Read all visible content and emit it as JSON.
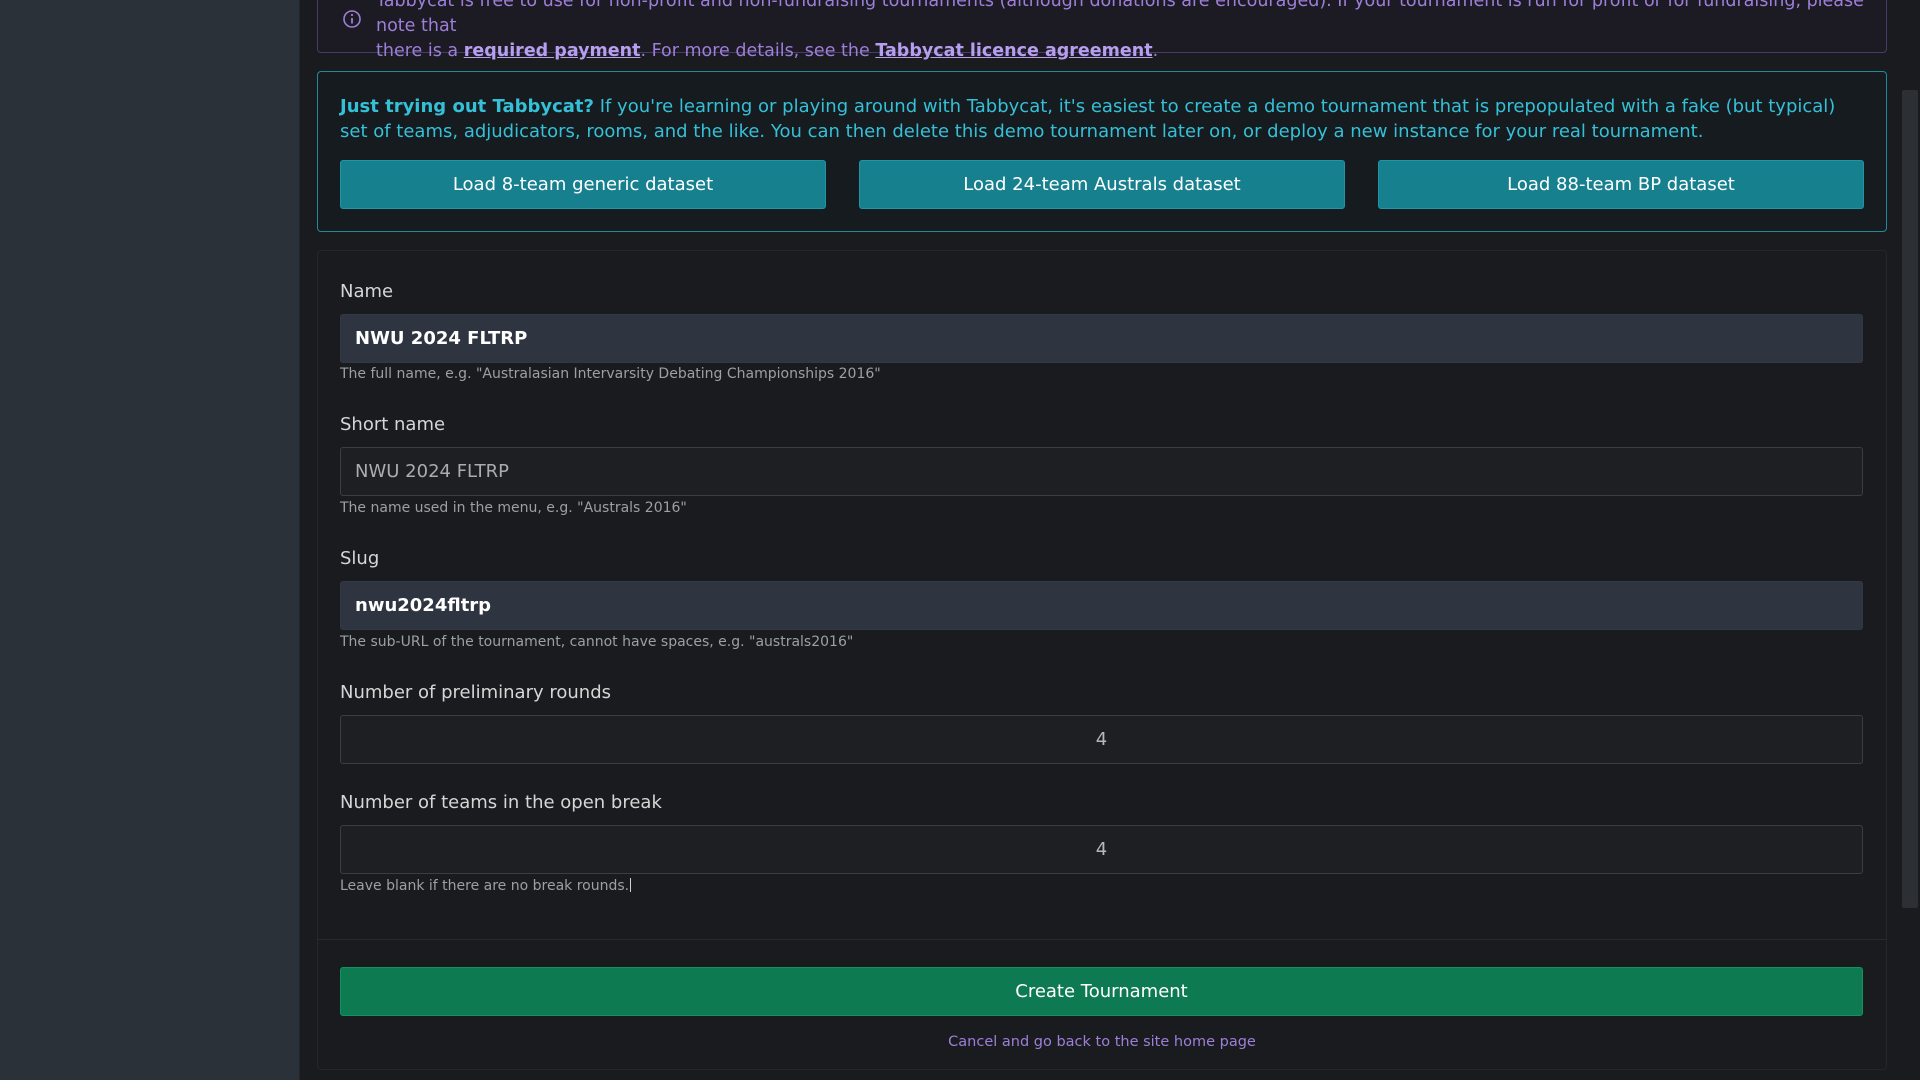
{
  "licence_notice": {
    "line1": "Tabbycat is free to use for non-profit and non-fundraising tournaments (although donations are encouraged). If your tournament is run for profit or for fundraising, please note that",
    "line2_prefix": "there is a ",
    "payment_link": "required payment",
    "line2_middle": ". For more details, see the ",
    "licence_link": "Tabbycat licence agreement",
    "line2_suffix": "."
  },
  "demo": {
    "heading": "Just trying out Tabbycat?",
    "body": " If you're learning or playing around with Tabbycat, it's easiest to create a demo tournament that is prepopulated with a fake (but typical) set of teams, adjudicators, rooms, and the like. You can then delete this demo tournament later on, or deploy a new instance for your real tournament.",
    "buttons": [
      "Load 8-team generic dataset",
      "Load 24-team Australs dataset",
      "Load 88-team BP dataset"
    ]
  },
  "form": {
    "name": {
      "label": "Name",
      "value": "NWU 2024 FLTRP",
      "help": "The full name, e.g. \"Australasian Intervarsity Debating Championships 2016\""
    },
    "short_name": {
      "label": "Short name",
      "placeholder": "NWU 2024 FLTRP",
      "help": "The name used in the menu, e.g. \"Australs 2016\""
    },
    "slug": {
      "label": "Slug",
      "value": "nwu2024fltrp",
      "help": "The sub-URL of the tournament, cannot have spaces, e.g. \"australs2016\""
    },
    "prelim_rounds": {
      "label": "Number of preliminary rounds",
      "value": "4"
    },
    "open_break": {
      "label": "Number of teams in the open break",
      "value": "4",
      "help": "Leave blank if there are no break rounds."
    },
    "submit_label": "Create Tournament",
    "cancel_label": "Cancel and go back to the site home page"
  },
  "colors": {
    "accent_teal": "#17808f",
    "success_green": "#0e7a52",
    "link_purple": "#9d7fd9"
  }
}
